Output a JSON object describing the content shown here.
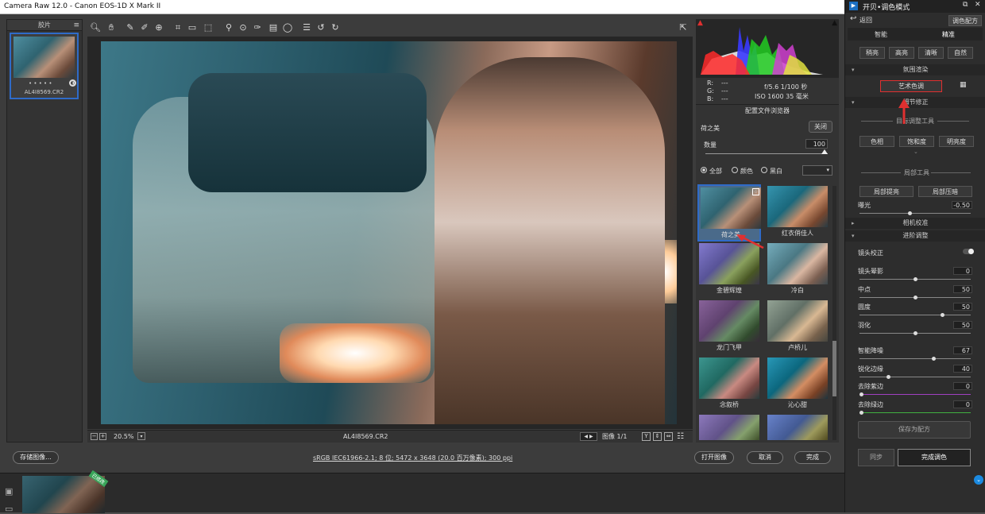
{
  "window": {
    "title": "Camera Raw 12.0 -  Canon EOS-1D X Mark II"
  },
  "filmstrip": {
    "header": "胶片",
    "stars": "• • • • •",
    "filename": "AL4I8569.CR2"
  },
  "toolbar": {
    "tools": [
      "zoom-icon",
      "hand-icon",
      "white-balance-icon",
      "color-sampler-icon",
      "target-adjust-icon",
      "crop-icon",
      "straighten-icon",
      "transform-icon",
      "spot-removal-icon",
      "red-eye-icon",
      "brush-icon",
      "graduated-filter-icon",
      "radial-filter-icon",
      "presets-list-icon",
      "rotate-left-icon",
      "rotate-right-icon"
    ],
    "open_prefs": "preferences-icon"
  },
  "canvas": {
    "zoom": "20.5%",
    "filename": "AL4I8569.CR2",
    "image_counter": "图像 1/1"
  },
  "histogram": {
    "rgb_labels": [
      "R:",
      "G:",
      "B:"
    ],
    "rgb_values": [
      "---",
      "---",
      "---"
    ],
    "exif_line1": "f/5.6   1/100 秒",
    "exif_line2": "ISO 1600   35 毫米"
  },
  "profile_browser": {
    "title": "配置文件浏览器",
    "selected": "荷之美",
    "close": "关闭",
    "amount_label": "数量",
    "amount_value": "100",
    "amount_fraction": 1.0,
    "filters": [
      "全部",
      "颜色",
      "黑白"
    ],
    "presets": [
      "荷之美",
      "红衣俏佳人",
      "金碧辉煌",
      "冷白",
      "龙门飞甲",
      "卢桥儿",
      "念叙桥",
      "沁心甜"
    ]
  },
  "status": {
    "save_button": "存储图像...",
    "info": "sRGB IEC61966-2.1; 8 位; 5472 x 3648 (20.0 百万像素); 300 ppi",
    "open_button": "打开图像",
    "cancel_button": "取消",
    "done_button": "完成"
  },
  "bottom_strip": {
    "badge": "已修改"
  },
  "plugin": {
    "title": "开贝•调色模式",
    "back": "返回",
    "recipe_button": "调色配方",
    "tabs": [
      "智能",
      "精准"
    ],
    "scene_buttons": [
      "稍亮",
      "高亮",
      "清晰",
      "自然"
    ],
    "section_atmosphere": "氛围渲染",
    "art_tone": "艺术色调",
    "section_detail": "细节修正",
    "target_tools": "目标调整工具",
    "target_buttons": [
      "色相",
      "饱和度",
      "明亮度"
    ],
    "local_tools": "局部工具",
    "local_buttons": [
      "局部提亮",
      "局部压暗"
    ],
    "exposure_label": "曝光",
    "exposure_value": "-0.50",
    "exposure_fraction": 0.45,
    "section_camera": "相机校准",
    "section_advanced": "进阶调整",
    "lens_correction": "镜头校正",
    "sliders": [
      {
        "label": "镜头晕影",
        "value": "0",
        "fraction": 0.5
      },
      {
        "label": "中点",
        "value": "50",
        "fraction": 0.5
      },
      {
        "label": "圆度",
        "value": "50",
        "fraction": 0.75
      },
      {
        "label": "羽化",
        "value": "50",
        "fraction": 0.5
      },
      {
        "label": "智能降噪",
        "value": "67",
        "fraction": 0.67
      },
      {
        "label": "锐化边缘",
        "value": "40",
        "fraction": 0.25
      },
      {
        "label": "去除紫边",
        "value": "0",
        "fraction": 0.0
      },
      {
        "label": "去除绿边",
        "value": "0",
        "fraction": 0.0
      }
    ],
    "save_as_recipe": "保存为配方",
    "sync": "同步",
    "finish": "完成调色"
  },
  "colors": {
    "accent": "#2f6bc8",
    "highlight_red": "#e03030",
    "plugin_bg": "#2d2d2d",
    "badge_green": "#3aa55a"
  }
}
